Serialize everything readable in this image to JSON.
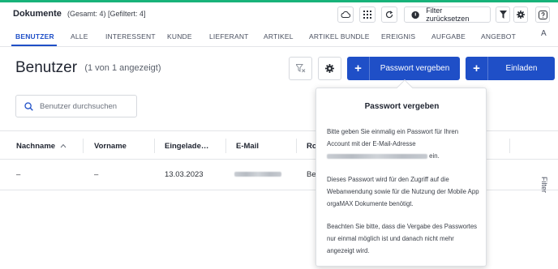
{
  "app": {
    "title": "Dokumente",
    "counts": "(Gesamt: 4) [Gefiltert: 4]",
    "accent": "#18b37a",
    "primary": "#1f4fc7"
  },
  "toolbar": {
    "filter_reset_label": "Filter zurücksetzen",
    "icons": [
      "cloud-icon",
      "grid-icon",
      "refresh-icon",
      "circle-icon",
      "filter-icon",
      "gear-icon",
      "help-icon"
    ]
  },
  "tabs": [
    "BENUTZER",
    "ALLE",
    "INTERESSENT",
    "KUNDE",
    "LIEFERANT",
    "ARTIKEL",
    "ARTIKEL BUNDLE",
    "EREIGNIS",
    "AUFGABE",
    "ANGEBOT"
  ],
  "tabs_overflow": "A",
  "active_tab": "BENUTZER",
  "page": {
    "title": "Benutzer",
    "subtitle": "(1 von 1 angezeigt)"
  },
  "actions": {
    "set_password_label": "Passwort vergeben",
    "invite_label": "Einladen",
    "plus": "+"
  },
  "search": {
    "placeholder": "Benutzer durchsuchen"
  },
  "table": {
    "columns": [
      "Nachname",
      "Vorname",
      "Eingelade…",
      "E-Mail",
      "Ro"
    ],
    "rows": [
      {
        "nachname": "–",
        "vorname": "–",
        "eingeladen": "13.03.2023",
        "email": "",
        "rolle": "Be"
      }
    ]
  },
  "side_panel_label": "Filter",
  "popover": {
    "title": "Passwort vergeben",
    "p1_line1": "Bitte geben Sie einmalig ein Passwort für Ihren",
    "p1_line2": "Account mit der E-Mail-Adresse",
    "p1_line3_suffix": "ein.",
    "p2": "Dieses Passwort wird für den Zugriff auf die Webanwendung sowie für die Nutzung der Mobile App orgaMAX Dokumente benötigt.",
    "p3": "Beachten Sie bitte, dass die Vergabe des Passwortes nur einmal möglich ist und danach nicht mehr angezeigt wird."
  }
}
